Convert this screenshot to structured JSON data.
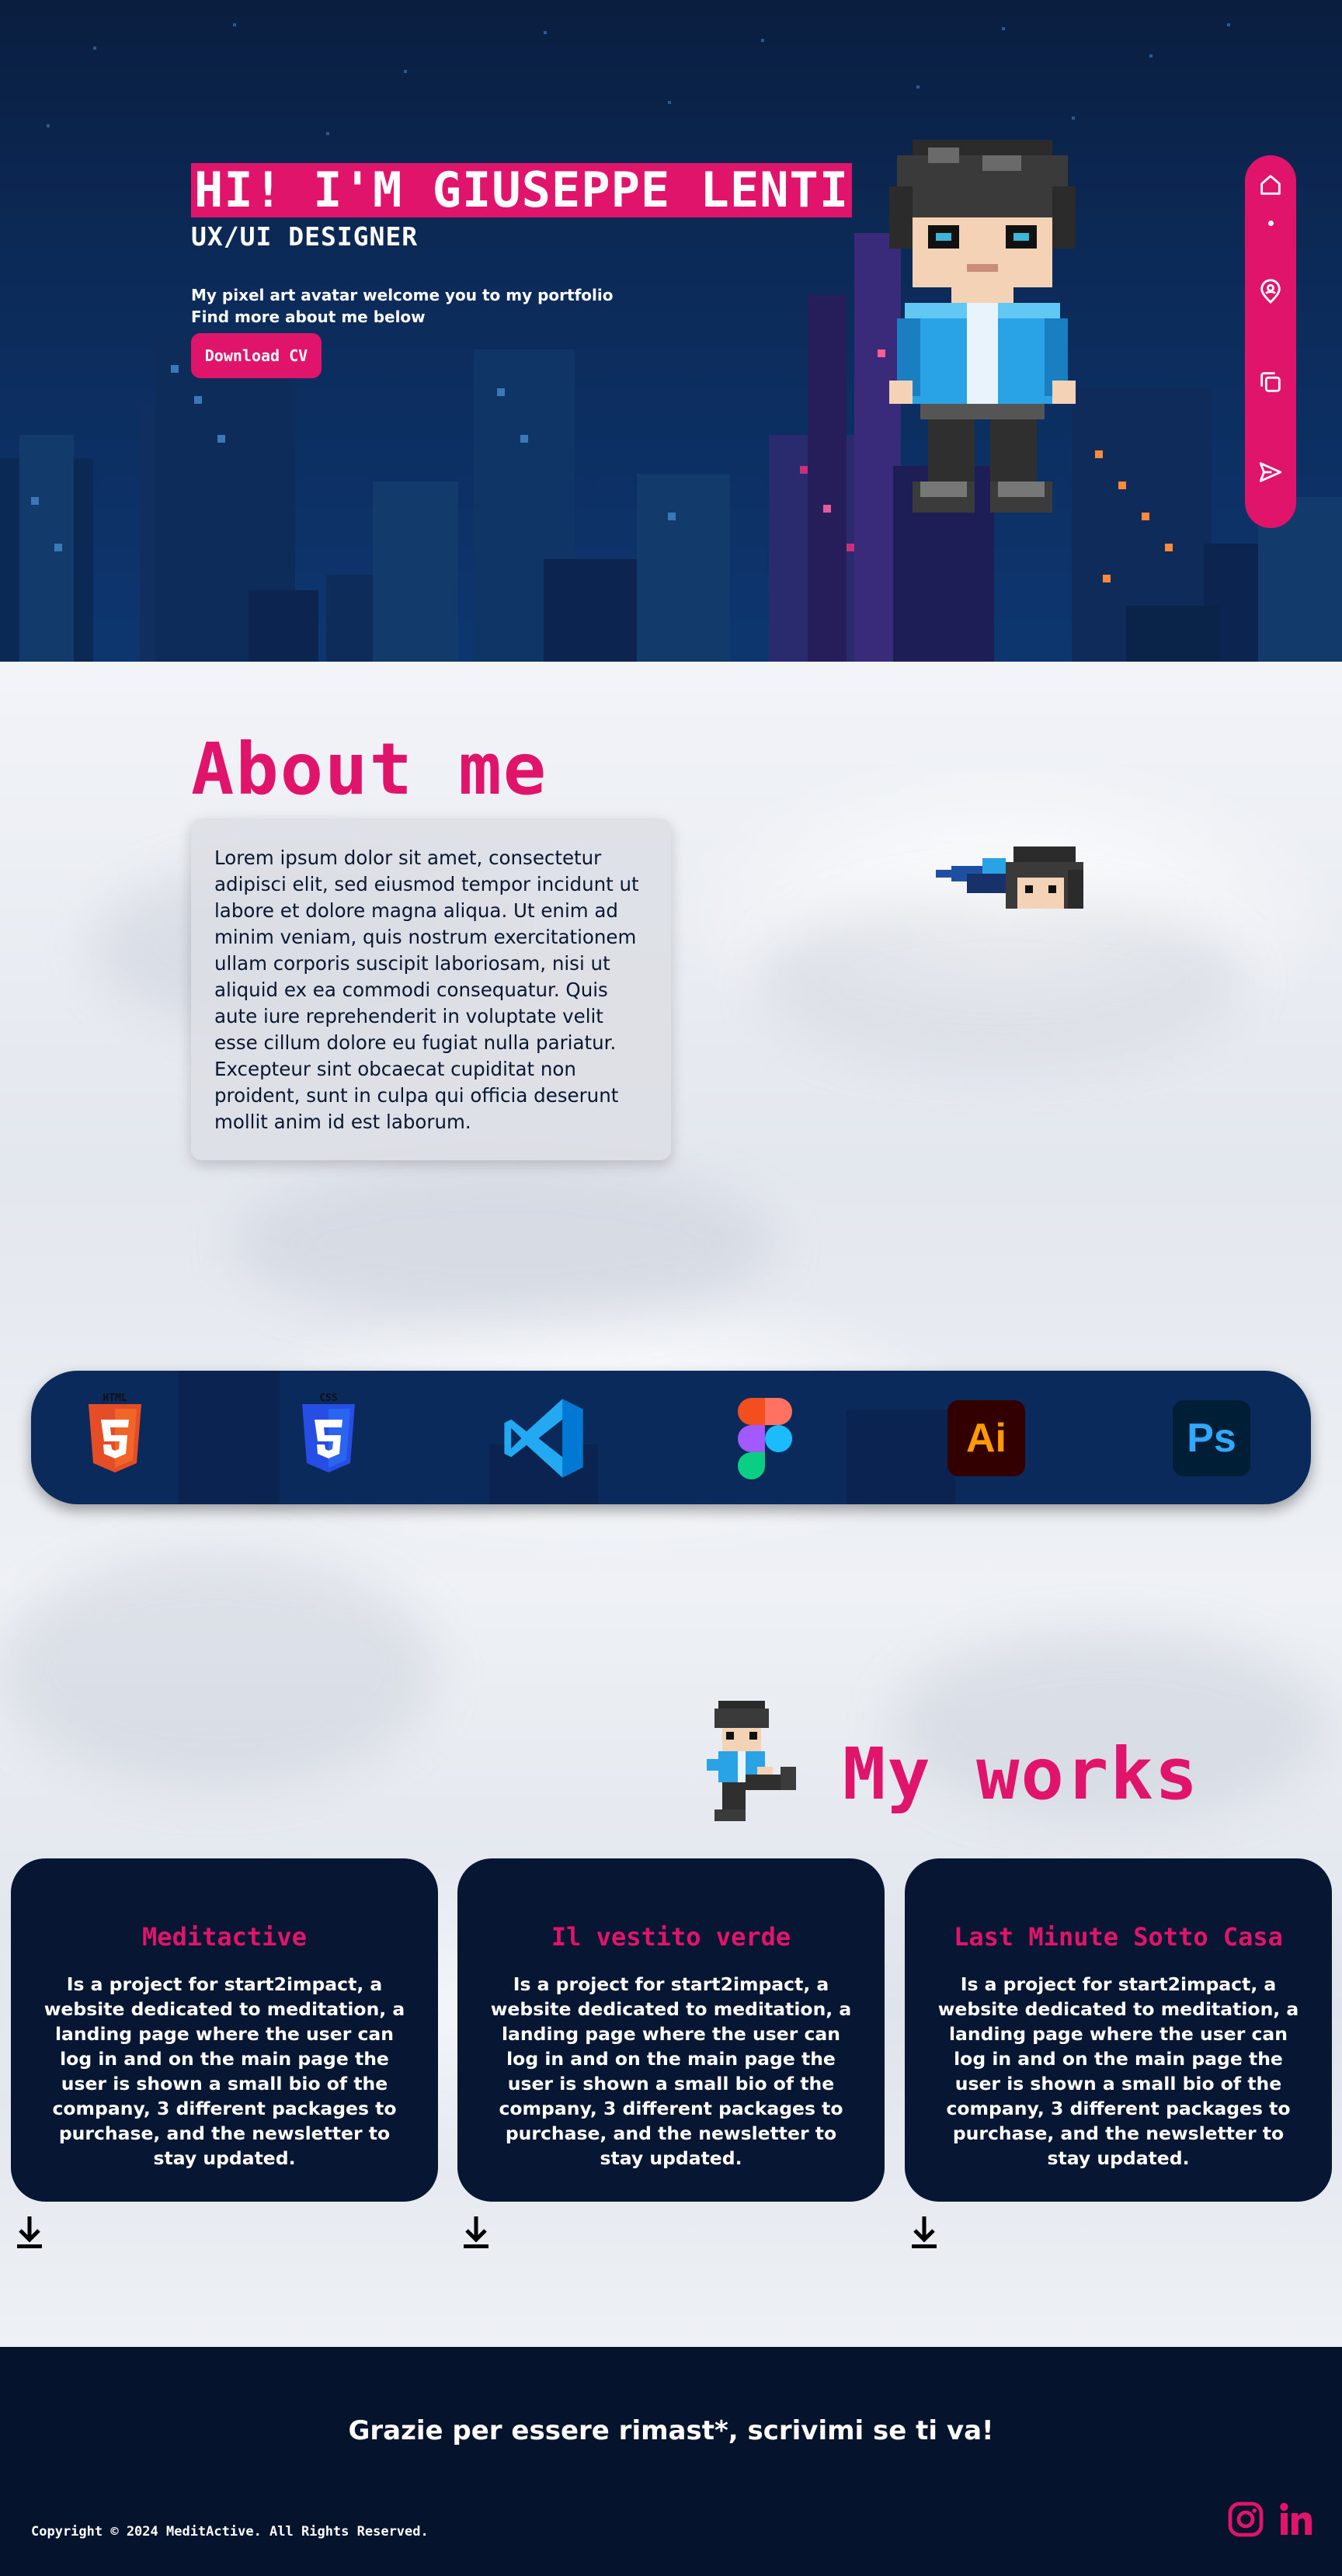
{
  "hero": {
    "title": "HI! I'M GIUSEPPE LENTI",
    "subtitle": "UX/UI DESIGNER",
    "line1": "My pixel art avatar welcome you to my portfolio",
    "line2": "Find more about me below",
    "cv_button": "Download CV"
  },
  "nav": {
    "items": [
      "home-icon",
      "user-pin-icon",
      "copy-icon",
      "send-icon"
    ],
    "active": "home-icon"
  },
  "about": {
    "title": "About me",
    "text": "Lorem ipsum dolor sit amet, consectetur adipisci elit, sed eiusmod tempor incidunt ut labore et dolore magna aliqua. Ut enim ad minim veniam, quis nostrum exercitationem ullam corporis suscipit laboriosam, nisi ut aliquid ex ea commodi consequatur. Quis aute iure reprehenderit in voluptate velit esse cillum dolore eu fugiat nulla pariatur. Excepteur sint obcaecat cupiditat non proident, sunt in culpa qui officia deserunt mollit anim id est laborum."
  },
  "tools": {
    "html_label": "HTML",
    "css_label": "CSS",
    "ai_label": "Ai",
    "ps_label": "Ps"
  },
  "works": {
    "title": "My works",
    "cards": [
      {
        "title": "Meditactive",
        "text": "Is a project for start2impact, a website dedicated to meditation, a landing page where the user can log in and on the main page the user is shown a small bio of the company, 3 different packages to purchase, and the newsletter to stay updated."
      },
      {
        "title": "Il vestito verde",
        "text": "Is a project for start2impact, a website dedicated to meditation, a landing page where the user can log in and on the main page the user is shown a small bio of the company, 3 different packages to purchase, and the newsletter to stay updated."
      },
      {
        "title": "Last Minute Sotto Casa",
        "text": "Is a project for start2impact, a website dedicated to meditation, a landing page where the user can log in and on the main page the user is shown a small bio of the company, 3 different packages to purchase, and the newsletter to stay updated."
      }
    ]
  },
  "footer": {
    "message": "Grazie per essere rimast*, scrivimi se ti va!",
    "copyright": "Copyright © 2024 MeditActive. All Rights Reserved."
  },
  "colors": {
    "accent": "#e0146a",
    "navy": "#071733",
    "hero_bg": "#0c2a58"
  }
}
